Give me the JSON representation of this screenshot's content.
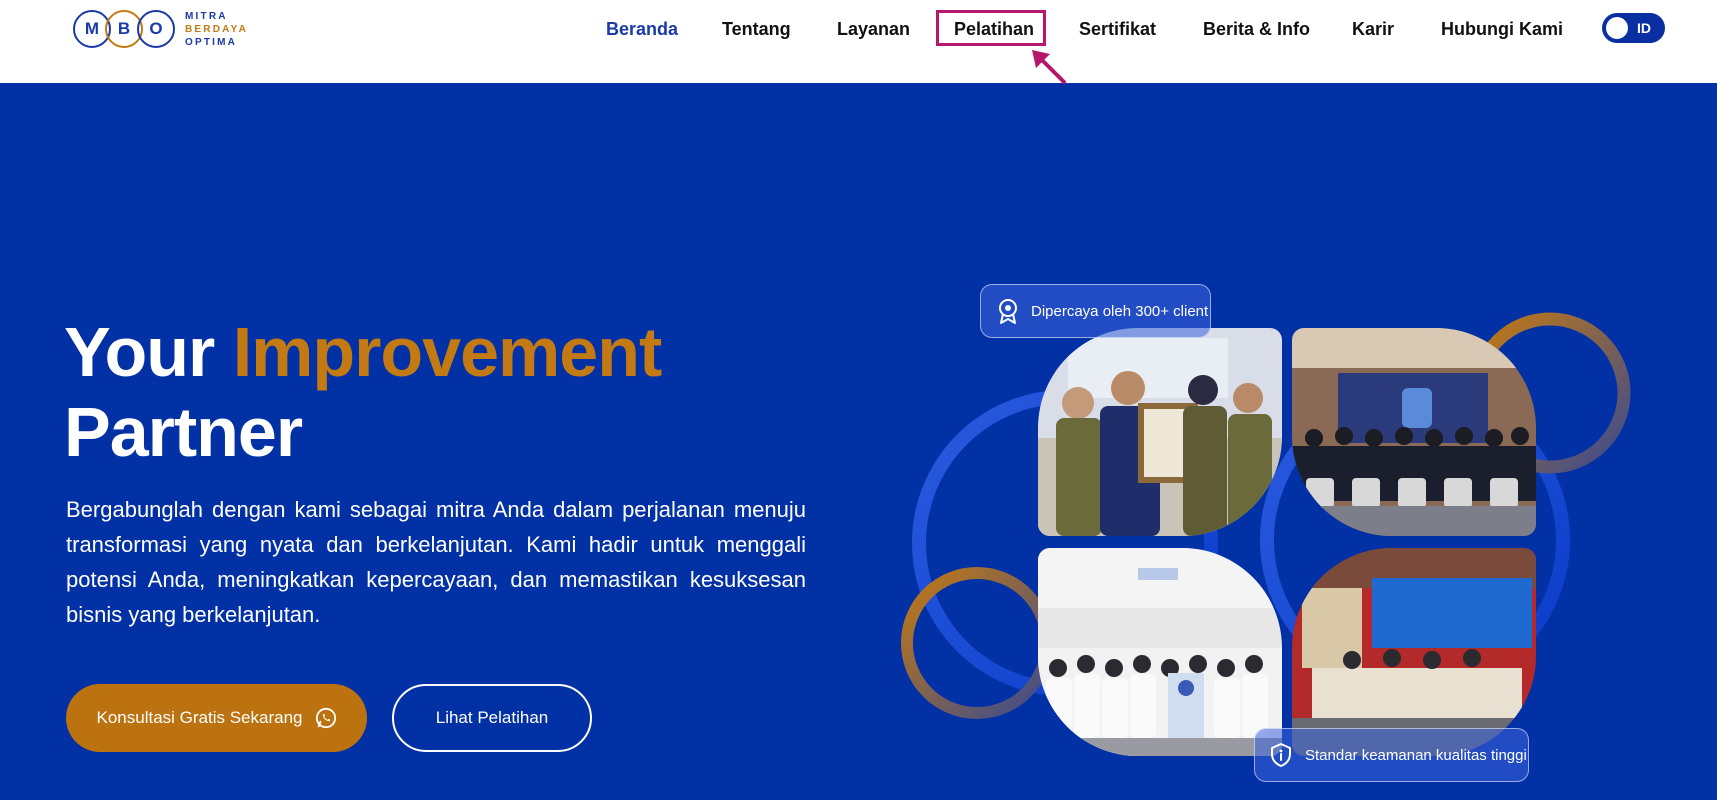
{
  "header": {
    "logo": {
      "letters": [
        "M",
        "B",
        "O"
      ],
      "lines": [
        "MITRA",
        "BERDAYA",
        "OPTIMA"
      ]
    },
    "nav": [
      {
        "label": "Beranda",
        "active": true
      },
      {
        "label": "Tentang",
        "active": false
      },
      {
        "label": "Layanan",
        "active": false
      },
      {
        "label": "Pelatihan",
        "active": false,
        "highlighted": true
      },
      {
        "label": "Sertifikat",
        "active": false
      },
      {
        "label": "Berita & Info",
        "active": false
      },
      {
        "label": "Karir",
        "active": false
      },
      {
        "label": "Hubungi Kami",
        "active": false
      }
    ],
    "lang": "ID"
  },
  "hero": {
    "title_part1": "Your",
    "title_accent": "Improvement",
    "title_part2": "Partner",
    "description": "Bergabunglah dengan kami sebagai mitra Anda dalam perjalanan menuju transformasi yang nyata dan berkelanjutan. Kami hadir untuk menggali potensi Anda, meningkatkan kepercayaan, dan memastikan kesuksesan bisnis yang berkelanjutan.",
    "cta_primary": "Konsultasi Gratis Sekarang",
    "cta_secondary": "Lihat Pelatihan"
  },
  "badges": {
    "top": "Dipercaya oleh 300+ client",
    "bottom": "Standar keamanan kualitas tinggi"
  },
  "icons": {
    "award": "award-icon",
    "shield": "shield-icon",
    "whatsapp": "whatsapp-icon",
    "arrow": "arrow-annotation-icon"
  },
  "colors": {
    "primary_blue": "#0230a5",
    "accent_orange": "#c47a12",
    "highlight_magenta": "#b5186a"
  }
}
